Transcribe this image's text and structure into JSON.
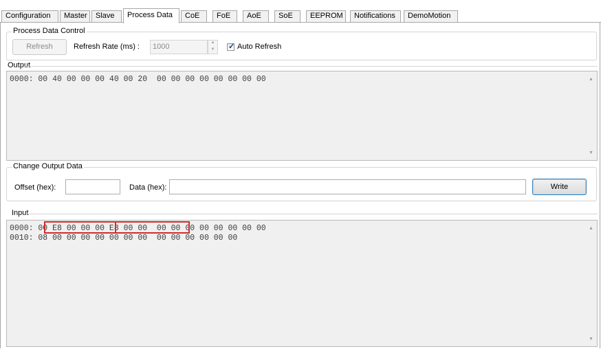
{
  "tabs": [
    {
      "label": "Configuration"
    },
    {
      "label": "Master"
    },
    {
      "label": "Slave"
    },
    {
      "label": "Process Data"
    },
    {
      "label": "CoE"
    },
    {
      "label": "FoE"
    },
    {
      "label": "AoE"
    },
    {
      "label": "SoE"
    },
    {
      "label": "EEPROM"
    },
    {
      "label": "Notifications"
    },
    {
      "label": "DemoMotion"
    }
  ],
  "active_tab": "Process Data",
  "process_data_control": {
    "title": "Process Data Control",
    "refresh_button": "Refresh",
    "refresh_rate_label": "Refresh Rate (ms) :",
    "refresh_rate_value": "1000",
    "auto_refresh_label": "Auto Refresh",
    "auto_refresh_checked": true
  },
  "output": {
    "title": "Output",
    "lines": [
      "0000: 00 40 00 00 00 40 00 20  00 00 00 00 00 00 00 00"
    ]
  },
  "change_output": {
    "title": "Change Output Data",
    "offset_label": "Offset (hex):",
    "offset_value": "",
    "data_label": "Data (hex):",
    "data_value": "",
    "write_button": "Write"
  },
  "input": {
    "title": "Input",
    "lines": [
      "0000: 00 E8 00 00 00 E8 00 00  00 00 00 00 00 00 00 00",
      "0010: 08 00 00 00 00 00 00 00  00 00 00 00 00 00"
    ]
  },
  "colors": {
    "highlight": "#d42a2a",
    "hex_background": "#f0f0f0"
  }
}
